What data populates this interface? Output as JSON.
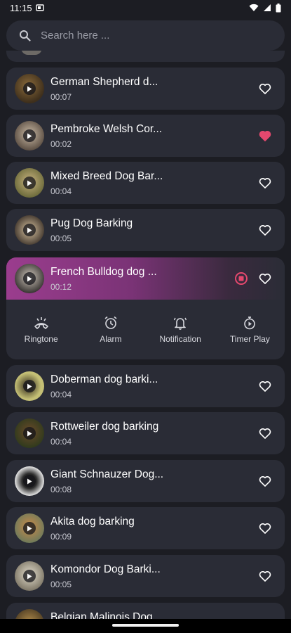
{
  "status": {
    "time": "11:15"
  },
  "search": {
    "placeholder": "Search here ..."
  },
  "items": [
    {
      "title": "German Shepherd d...",
      "duration": "00:07",
      "favorite": false,
      "thumb_color": "#5b4a2f"
    },
    {
      "title": "Pembroke Welsh Cor...",
      "duration": "00:02",
      "favorite": true,
      "thumb_color": "#7a6a5a"
    },
    {
      "title": "Mixed Breed Dog Bar...",
      "duration": "00:04",
      "favorite": false,
      "thumb_color": "#8c7a4d"
    },
    {
      "title": "Pug Dog Barking",
      "duration": "00:05",
      "favorite": false,
      "thumb_color": "#a59074"
    },
    {
      "title": "French Bulldog dog ...",
      "duration": "00:12",
      "favorite": false,
      "thumb_color": "#4e4a45"
    },
    {
      "title": "Doberman dog barki...",
      "duration": "00:04",
      "favorite": false,
      "thumb_color": "#b7b36a"
    },
    {
      "title": "Rottweiler dog barking",
      "duration": "00:04",
      "favorite": false,
      "thumb_color": "#4e5a30"
    },
    {
      "title": "Giant Schnauzer Dog...",
      "duration": "00:08",
      "favorite": false,
      "thumb_color": "#d2d2d2"
    },
    {
      "title": "Akita dog barking",
      "duration": "00:09",
      "favorite": false,
      "thumb_color": "#7e8a6a"
    },
    {
      "title": "Komondor Dog Barki...",
      "duration": "00:05",
      "favorite": false,
      "thumb_color": "#b9b39e"
    },
    {
      "title": "Belgian Malinois Dog...",
      "duration": "",
      "favorite": false,
      "thumb_color": "#8a7044"
    }
  ],
  "actions": [
    {
      "label": "Ringtone",
      "icon": "phone-ringing-icon"
    },
    {
      "label": "Alarm",
      "icon": "alarm-clock-icon"
    },
    {
      "label": "Notification",
      "icon": "bell-ringing-icon"
    },
    {
      "label": "Timer Play",
      "icon": "stopwatch-play-icon"
    }
  ],
  "colors": {
    "favorite_active": "#e5486e",
    "accent_gradient_start": "#9b3d8e",
    "stop_icon": "#e5486e"
  }
}
